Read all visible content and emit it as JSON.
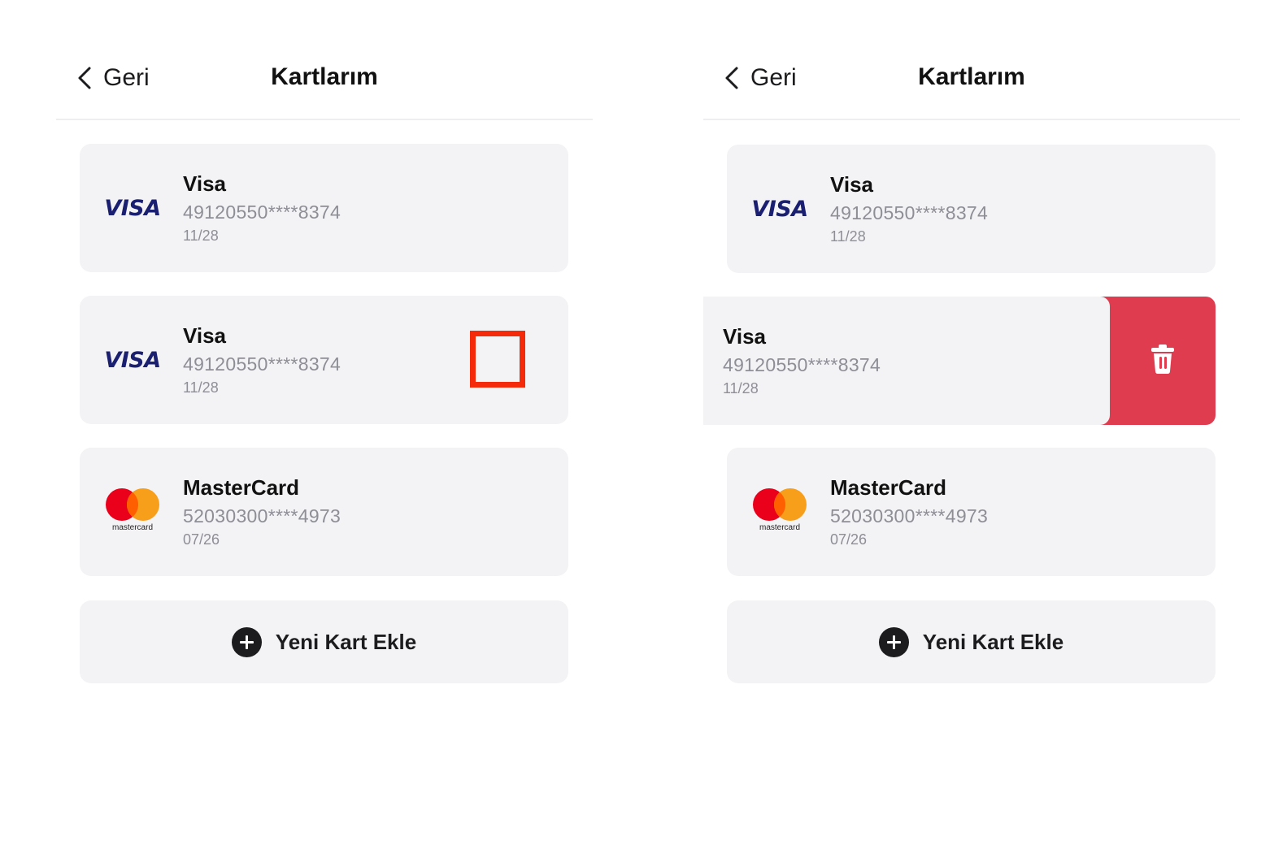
{
  "screens": [
    {
      "header": {
        "back_label": "Geri",
        "title": "Kartlarım"
      },
      "cards": [
        {
          "brand": "visa",
          "logo_text": "VISA",
          "name": "Visa",
          "number": "49120550****8374",
          "expiry": "11/28"
        },
        {
          "brand": "visa",
          "logo_text": "VISA",
          "name": "Visa",
          "number": "49120550****8374",
          "expiry": "11/28",
          "highlighted": true
        },
        {
          "brand": "mastercard",
          "logo_text": "mastercard",
          "name": "MasterCard",
          "number": "52030300****4973",
          "expiry": "07/26"
        }
      ],
      "add_button_label": "Yeni Kart Ekle"
    },
    {
      "header": {
        "back_label": "Geri",
        "title": "Kartlarım"
      },
      "cards": [
        {
          "brand": "visa",
          "logo_text": "VISA",
          "name": "Visa",
          "number": "49120550****8374",
          "expiry": "11/28"
        },
        {
          "brand": "visa",
          "name": "Visa",
          "number": "49120550****8374",
          "expiry": "11/28",
          "swiped": true,
          "action_icon": "trash-icon"
        },
        {
          "brand": "mastercard",
          "logo_text": "mastercard",
          "name": "MasterCard",
          "number": "52030300****4973",
          "expiry": "07/26"
        }
      ],
      "add_button_label": "Yeni Kart Ekle"
    }
  ],
  "colors": {
    "card_background": "#f3f3f5",
    "highlight_box": "#f42a0b",
    "delete_action": "#e03c50",
    "visa_blue": "#1a1f71",
    "mastercard_red": "#eb001b",
    "mastercard_orange": "#f79e1b",
    "secondary_text": "#8e8e96"
  }
}
